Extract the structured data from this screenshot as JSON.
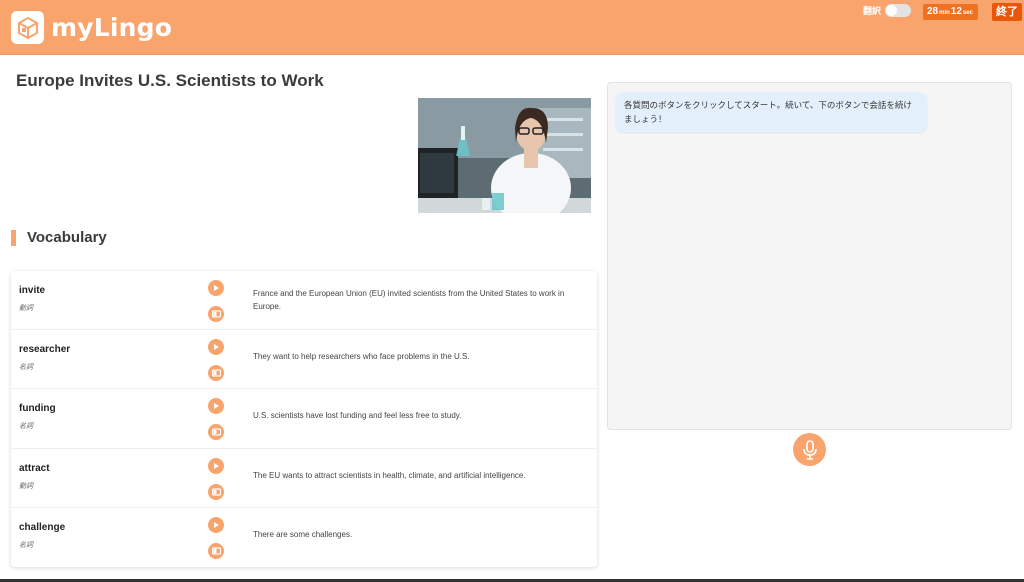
{
  "app": {
    "name": "myLingo"
  },
  "header": {
    "translate_label": "翻訳",
    "timer": {
      "minutes": "28",
      "min_unit": "min",
      "seconds": "12",
      "sec_unit": "sec"
    },
    "end_label": "終了"
  },
  "article": {
    "title": "Europe Invites U.S. Scientists to Work"
  },
  "vocabulary": {
    "heading": "Vocabulary",
    "items": [
      {
        "word": "invite",
        "pos": "動詞",
        "sentence": "France and the European Union (EU) invited scientists from the United States to work in Europe."
      },
      {
        "word": "researcher",
        "pos": "名詞",
        "sentence": "They want to help researchers who face problems in the U.S."
      },
      {
        "word": "funding",
        "pos": "名詞",
        "sentence": "U.S. scientists have lost funding and feel less free to study."
      },
      {
        "word": "attract",
        "pos": "動詞",
        "sentence": "The EU wants to attract scientists in health, climate, and artificial intelligence."
      },
      {
        "word": "challenge",
        "pos": "名詞",
        "sentence": "There are some challenges."
      }
    ]
  },
  "chat": {
    "messages": [
      {
        "text": "各質問のボタンをクリックしてスタート。続いて、下のボタンで会話を続けましょう！"
      }
    ]
  },
  "icons": {
    "logo": "logo-cube-icon",
    "play": "play-icon",
    "book": "book-icon",
    "mic": "microphone-icon"
  },
  "colors": {
    "brand": "#f9a46c",
    "timer": "#f0711f",
    "end_button": "#e8560a",
    "chat_bubble": "#e3f0fc"
  }
}
